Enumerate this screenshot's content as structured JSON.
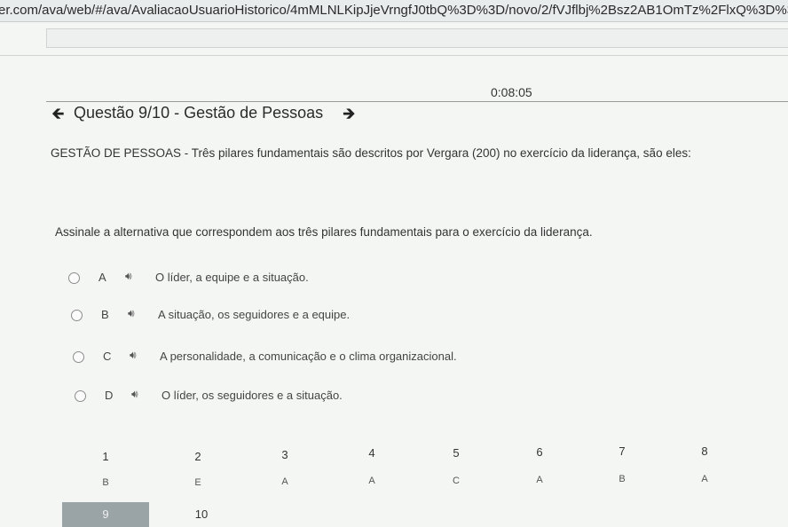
{
  "browser": {
    "url": "er.com/ava/web/#/ava/AvaliacaoUsuarioHistorico/4mMLNLKipJjeVrngfJ0tbQ%3D%3D/novo/2/fVJflbj%2Bsz2AB1OmTz%2FlxQ%3D%3D"
  },
  "timer": "0:08:05",
  "question": {
    "title": "Questão 9/10 - Gestão de Pessoas",
    "text": "GESTÃO DE PESSOAS - Três pilares fundamentais são descritos por Vergara (200) no exercício da liderança, são eles:",
    "prompt": "Assinale a alternativa que correspondem aos três pilares fundamentais para o exercício da liderança.",
    "options": [
      {
        "letter": "A",
        "text": "O líder, a equipe e a situação."
      },
      {
        "letter": "B",
        "text": "A situação, os seguidores e a equipe."
      },
      {
        "letter": "C",
        "text": "A personalidade, a comunicação e o clima organizacional."
      },
      {
        "letter": "D",
        "text": "O líder, os seguidores e a situação."
      }
    ]
  },
  "navigator": {
    "items": [
      {
        "number": "1",
        "answer": "B"
      },
      {
        "number": "2",
        "answer": "E"
      },
      {
        "number": "3",
        "answer": "A"
      },
      {
        "number": "4",
        "answer": "A"
      },
      {
        "number": "5",
        "answer": "C"
      },
      {
        "number": "6",
        "answer": "A"
      },
      {
        "number": "7",
        "answer": "B"
      },
      {
        "number": "8",
        "answer": "A"
      },
      {
        "number": "9",
        "answer": ""
      },
      {
        "number": "10",
        "answer": ""
      }
    ],
    "current": "9"
  },
  "icons": {
    "prev": "arrow-left-icon",
    "next": "arrow-right-icon",
    "audio": "speaker-icon"
  }
}
